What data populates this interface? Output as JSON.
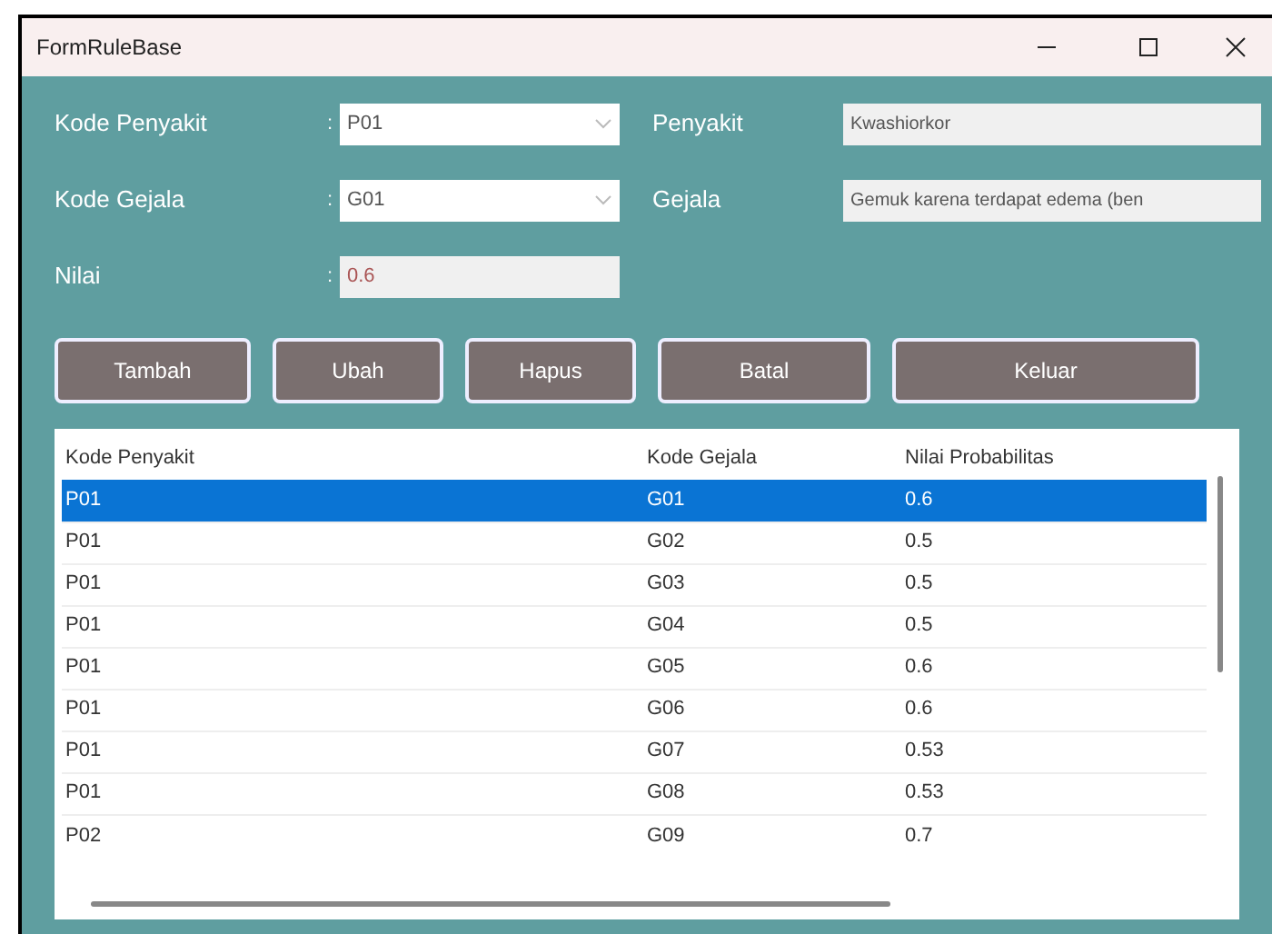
{
  "window": {
    "title": "FormRuleBase"
  },
  "form": {
    "fields": [
      {
        "kind": "combo",
        "label": "Kode Penyakit",
        "colon": ":",
        "value": "P01",
        "side_label": "Penyakit",
        "side_value": "Kwashiorkor"
      },
      {
        "kind": "combo",
        "label": "Kode Gejala",
        "colon": ":",
        "value": "G01",
        "side_label": "Gejala",
        "side_value": "Gemuk karena terdapat edema (ben"
      },
      {
        "kind": "text",
        "label": "Nilai",
        "colon": ":",
        "value": "0.6"
      }
    ]
  },
  "buttons": [
    "Tambah",
    "Ubah",
    "Hapus",
    "Batal",
    "Keluar"
  ],
  "table": {
    "columns": [
      "Kode Penyakit",
      "Kode Gejala",
      "Nilai Probabilitas"
    ],
    "rows": [
      {
        "cells": [
          "P01",
          "G01",
          "0.6"
        ],
        "selected": true
      },
      {
        "cells": [
          "P01",
          "G02",
          "0.5"
        ],
        "selected": false
      },
      {
        "cells": [
          "P01",
          "G03",
          "0.5"
        ],
        "selected": false
      },
      {
        "cells": [
          "P01",
          "G04",
          "0.5"
        ],
        "selected": false
      },
      {
        "cells": [
          "P01",
          "G05",
          "0.6"
        ],
        "selected": false
      },
      {
        "cells": [
          "P01",
          "G06",
          "0.6"
        ],
        "selected": false
      },
      {
        "cells": [
          "P01",
          "G07",
          "0.53"
        ],
        "selected": false
      },
      {
        "cells": [
          "P01",
          "G08",
          "0.53"
        ],
        "selected": false
      },
      {
        "cells": [
          "P02",
          "G09",
          "0.7"
        ],
        "selected": false
      }
    ]
  }
}
